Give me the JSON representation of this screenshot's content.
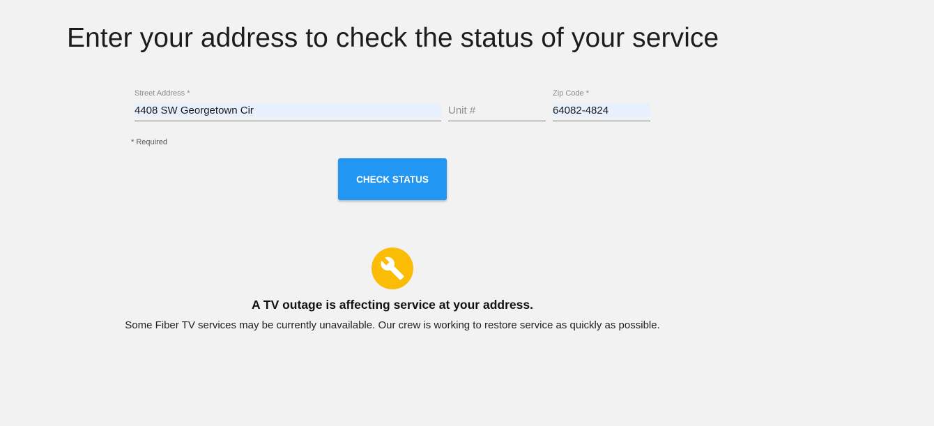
{
  "page": {
    "title": "Enter your address to check the status of your service"
  },
  "form": {
    "street": {
      "label": "Street Address *",
      "value": "4408 SW Georgetown Cir"
    },
    "unit": {
      "placeholder": "Unit #",
      "value": ""
    },
    "zip": {
      "label": "Zip Code *",
      "value": "64082-4824"
    },
    "required_note": "* Required",
    "submit_label": "CHECK STATUS"
  },
  "status": {
    "icon": "wrench-icon",
    "icon_color": "#fbbc05",
    "heading": "A TV outage is affecting service at your address.",
    "message": "Some Fiber TV services may be currently unavailable. Our crew is working to restore service as quickly as possible."
  },
  "colors": {
    "background": "#f2f2f2",
    "accent": "#2196f3",
    "autofill": "#e8f0fe"
  }
}
